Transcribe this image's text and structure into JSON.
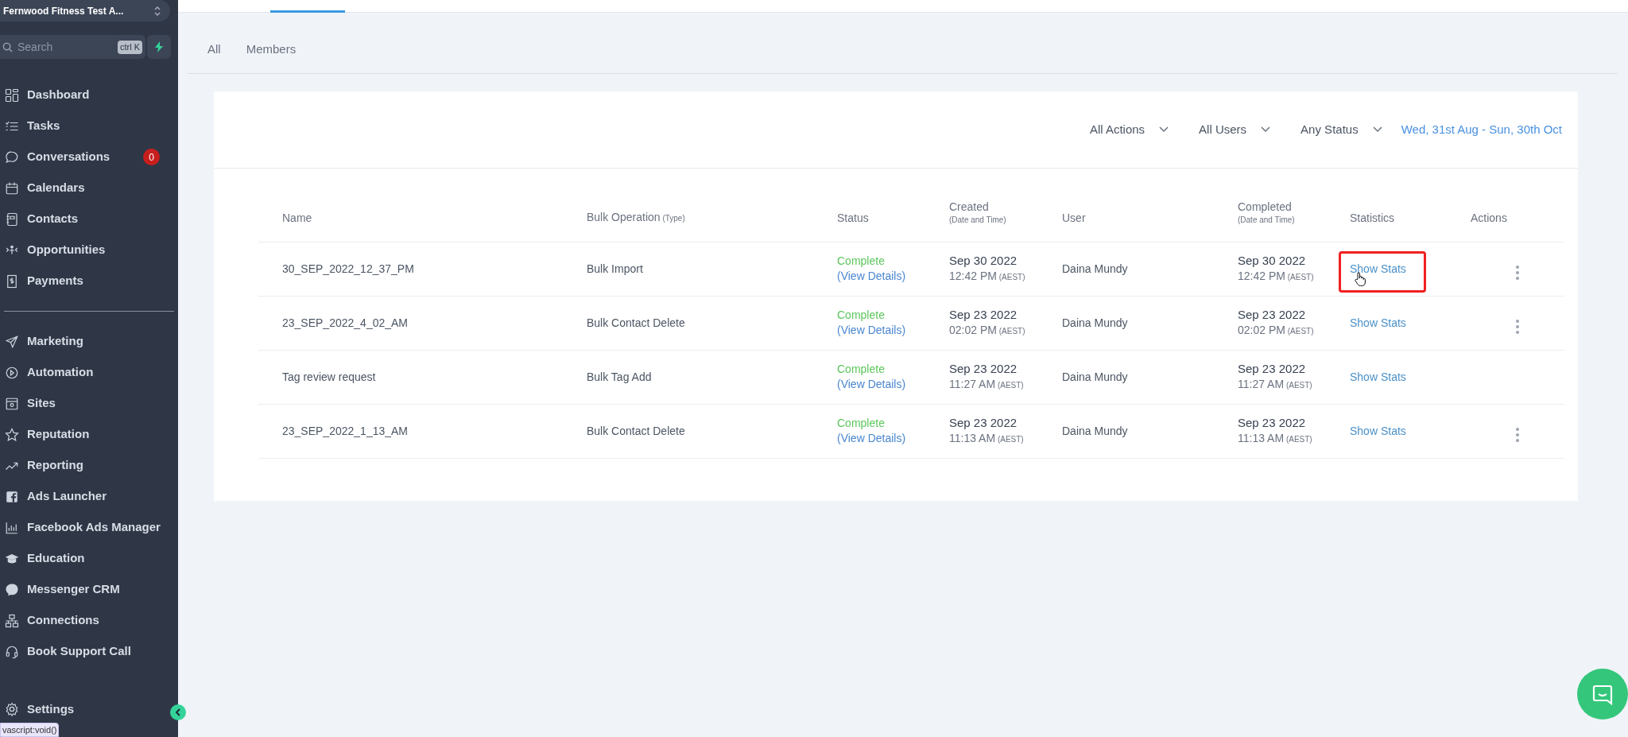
{
  "sidebar": {
    "account": "Fernwood Fitness Test A...",
    "search": {
      "placeholder": "Search",
      "shortcut": "ctrl K"
    },
    "items": [
      {
        "kind": "dashboard",
        "label": "Dashboard"
      },
      {
        "kind": "tasks",
        "label": "Tasks"
      },
      {
        "kind": "chat",
        "label": "Conversations",
        "badge": "0"
      },
      {
        "kind": "calendar",
        "label": "Calendars"
      },
      {
        "kind": "contacts",
        "label": "Contacts"
      },
      {
        "kind": "opportunities",
        "label": "Opportunities"
      },
      {
        "kind": "payments",
        "label": "Payments"
      },
      {
        "kind": "divider"
      },
      {
        "kind": "marketing",
        "label": "Marketing"
      },
      {
        "kind": "automation",
        "label": "Automation"
      },
      {
        "kind": "sites",
        "label": "Sites"
      },
      {
        "kind": "star",
        "label": "Reputation"
      },
      {
        "kind": "reporting",
        "label": "Reporting"
      },
      {
        "kind": "facebook",
        "label": "Ads Launcher"
      },
      {
        "kind": "barchart",
        "label": "Facebook Ads Manager"
      },
      {
        "kind": "education",
        "label": "Education"
      },
      {
        "kind": "messenger",
        "label": "Messenger CRM"
      },
      {
        "kind": "connections",
        "label": "Connections"
      },
      {
        "kind": "support",
        "label": "Book Support Call"
      }
    ],
    "settings": "Settings"
  },
  "status_tooltip": "vascript:void()",
  "tabs": [
    {
      "label": "All",
      "selected": false
    },
    {
      "label": "Members",
      "selected": false
    }
  ],
  "filters": [
    {
      "label": "All Actions"
    },
    {
      "label": "All Users"
    },
    {
      "label": "Any Status"
    }
  ],
  "date_range": "Wed, 31st Aug - Sun, 30th Oct",
  "table": {
    "columns": [
      {
        "label": "Name"
      },
      {
        "label": "Bulk Operation",
        "note": "(Type)"
      },
      {
        "label": "Status"
      },
      {
        "label": "Created",
        "sub": "(Date and Time)"
      },
      {
        "label": "User"
      },
      {
        "label": "Completed",
        "sub": "(Date and Time)"
      },
      {
        "label": "Statistics"
      },
      {
        "label": "Actions"
      }
    ],
    "rows": [
      {
        "name": "30_SEP_2022_12_37_PM",
        "operation": "Bulk Import",
        "status": "Complete",
        "details": "(View Details)",
        "created_date": "Sep 30 2022",
        "created_time": "12:42 PM",
        "created_tz": "(AEST)",
        "user": "Daina Mundy",
        "completed_date": "Sep 30 2022",
        "completed_time": "12:42 PM",
        "completed_tz": "(AEST)",
        "stats": "Show Stats",
        "highlighted": true,
        "has_menu": true
      },
      {
        "name": "23_SEP_2022_4_02_AM",
        "operation": "Bulk Contact Delete",
        "status": "Complete",
        "details": "(View Details)",
        "created_date": "Sep 23 2022",
        "created_time": "02:02 PM",
        "created_tz": "(AEST)",
        "user": "Daina Mundy",
        "completed_date": "Sep 23 2022",
        "completed_time": "02:02 PM",
        "completed_tz": "(AEST)",
        "stats": "Show Stats",
        "highlighted": false,
        "has_menu": true
      },
      {
        "name": "Tag review request",
        "operation": "Bulk Tag Add",
        "status": "Complete",
        "details": "(View Details)",
        "created_date": "Sep 23 2022",
        "created_time": "11:27 AM",
        "created_tz": "(AEST)",
        "user": "Daina Mundy",
        "completed_date": "Sep 23 2022",
        "completed_time": "11:27 AM",
        "completed_tz": "(AEST)",
        "stats": "Show Stats",
        "highlighted": false,
        "has_menu": false
      },
      {
        "name": "23_SEP_2022_1_13_AM",
        "operation": "Bulk Contact Delete",
        "status": "Complete",
        "details": "(View Details)",
        "created_date": "Sep 23 2022",
        "created_time": "11:13 AM",
        "created_tz": "(AEST)",
        "user": "Daina Mundy",
        "completed_date": "Sep 23 2022",
        "completed_time": "11:13 AM",
        "completed_tz": "(AEST)",
        "stats": "Show Stats",
        "highlighted": false,
        "has_menu": true
      }
    ]
  }
}
